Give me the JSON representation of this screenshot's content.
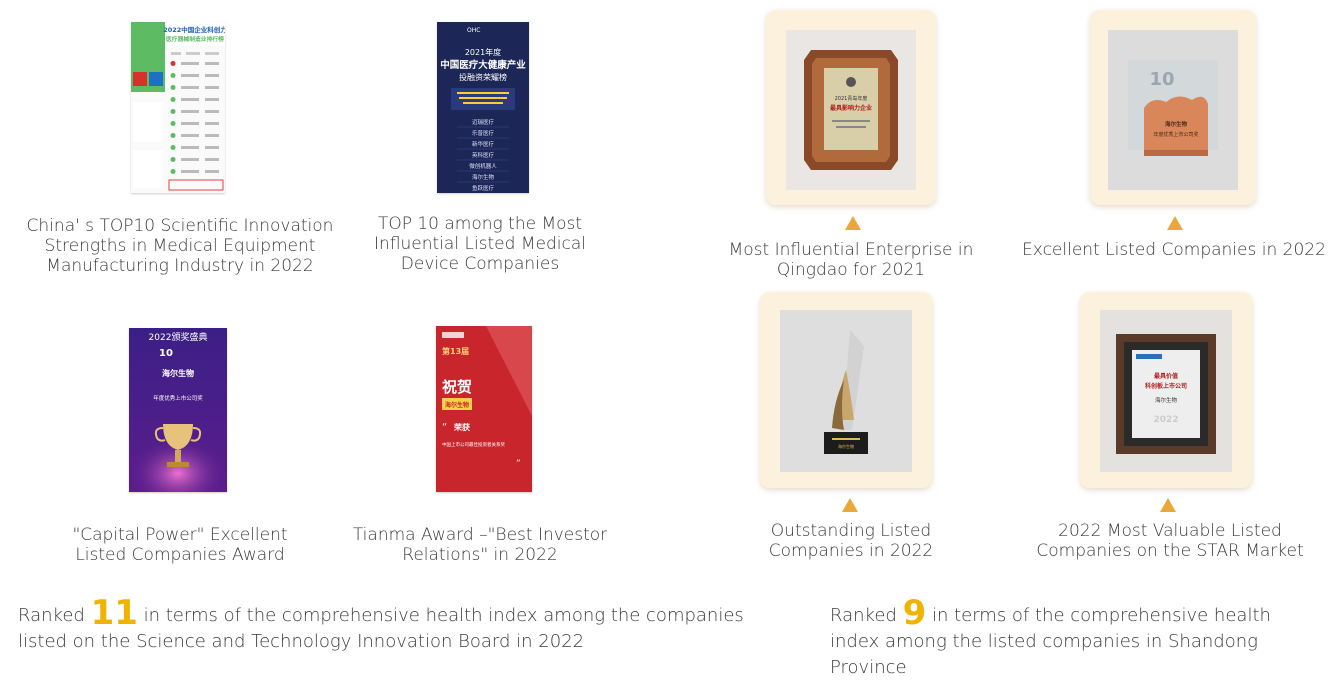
{
  "left_awards": [
    {
      "caption_lines": [
        "China' s TOP10 Scientific Innovation",
        "Strengths in Medical Equipment",
        "Manufacturing Industry in 2022"
      ],
      "poster_heading": "2022中国企业科创力",
      "poster_subheading": "医疗器械制造业排行榜"
    },
    {
      "caption_lines": [
        "TOP 10 among the Most",
        "Influential Listed Medical",
        "Device Companies"
      ],
      "poster_brand": "OHC",
      "poster_heading": "2021年度",
      "poster_title": "中国医疗大健康产业",
      "poster_subtitle": "投融资荣耀榜",
      "poster_list": [
        "迈瑞医疗",
        "乐普医疗",
        "新华医疗",
        "英科医疗",
        "微创机器人",
        "海尔生物",
        "鱼跃医疗"
      ]
    },
    {
      "caption_lines": [
        "\"Capital Power\" Excellent",
        "Listed Companies Award"
      ],
      "poster_heading": "2022颁奖盛典",
      "poster_company": "海尔生物",
      "poster_award": "年度优秀上市公司奖"
    },
    {
      "caption_lines": [
        "Tianma Award –\"Best Investor",
        "Relations\" in 2022"
      ],
      "poster_congrats": "祝贺",
      "poster_company": "海尔生物",
      "poster_won": "荣获",
      "poster_award": "中国上市公司最佳投资者关系奖"
    }
  ],
  "right_awards": [
    {
      "caption_lines": [
        "Most Influential Enterprise in",
        "Qingdao for 2021"
      ],
      "plaque_text": [
        "2021青岛年度",
        "最具影响力企业"
      ]
    },
    {
      "caption_lines": [
        "Excellent Listed Companies in 2022"
      ],
      "plaque_text": [
        "10",
        "海尔生物",
        "年度优秀上市公司奖"
      ]
    },
    {
      "caption_lines": [
        "Outstanding Listed",
        "Companies in 2022"
      ],
      "plaque_text": [
        "海尔生物"
      ]
    },
    {
      "caption_lines": [
        "2022 Most Valuable Listed",
        "Companies on the STAR Market"
      ],
      "plaque_text": [
        "最具价值",
        "科创板上市公司",
        "海尔生物",
        "2022"
      ]
    }
  ],
  "rank_left": {
    "prefix": "Ranked ",
    "number": "11",
    "line1_suffix": " in terms of the comprehensive health index among the companies",
    "line2": "listed on the Science and Technology Innovation Board in 2022"
  },
  "rank_right": {
    "prefix": "Ranked ",
    "number": "9",
    "line1_suffix": " in terms of the comprehensive health",
    "line2": "index among the listed companies in Shandong Province"
  },
  "colors": {
    "accent": "#f0b400",
    "triangle": "#e8a93a",
    "frame": "#fbf1dc",
    "navy_poster": "#1f2a5e",
    "red_poster": "#c8262c",
    "purple_poster": "#3a1f7a"
  }
}
